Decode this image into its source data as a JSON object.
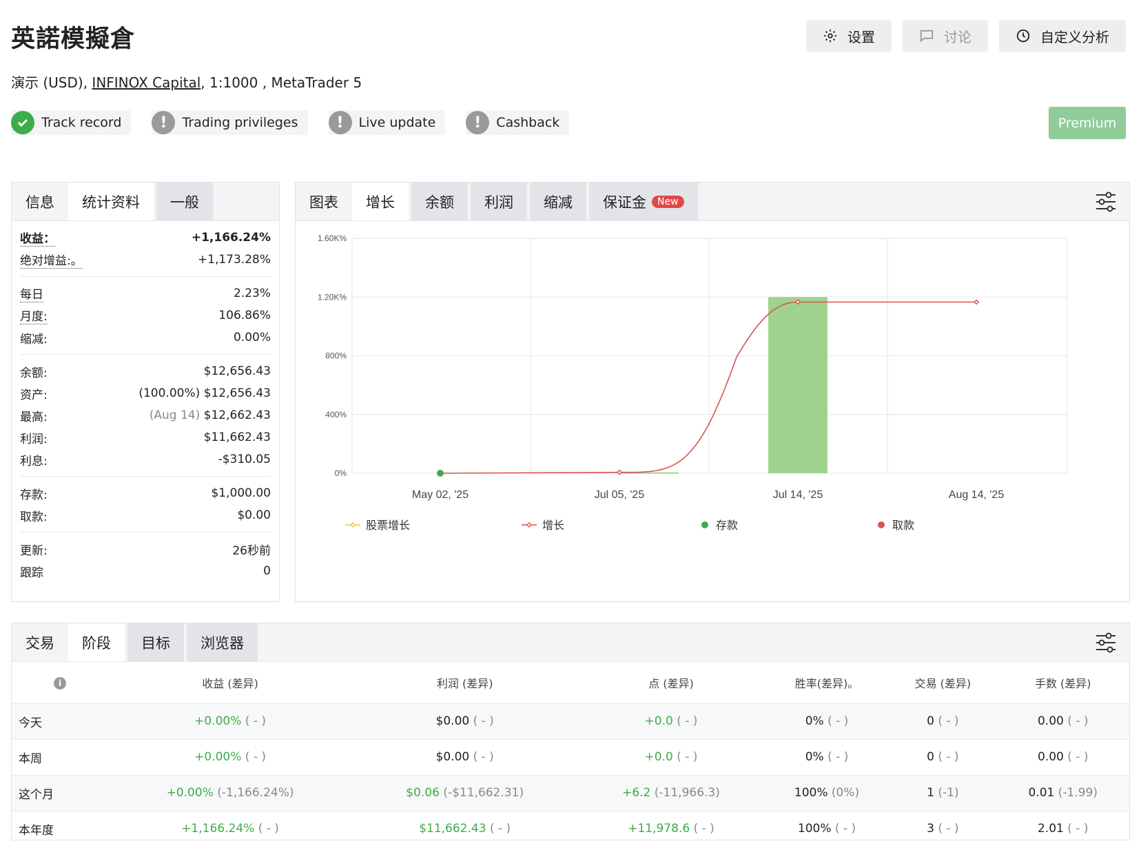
{
  "header": {
    "title": "英諾模擬倉",
    "subtitle_prefix": "演示 (USD), ",
    "broker_link": "INFINOX Capital",
    "subtitle_suffix": ", 1:1000 , MetaTrader 5",
    "buttons": {
      "settings": "设置",
      "discuss": "讨论",
      "custom_analysis": "自定义分析"
    }
  },
  "badges": [
    {
      "label": "Track record",
      "status": "ok"
    },
    {
      "label": "Trading privileges",
      "status": "warn"
    },
    {
      "label": "Live update",
      "status": "warn"
    },
    {
      "label": "Cashback",
      "status": "warn"
    }
  ],
  "premium_label": "Premium",
  "info_panel": {
    "tabs": [
      "信息",
      "统计资料",
      "一般"
    ],
    "rows": {
      "gain_label": "收益：",
      "gain_value": "+1,166.24%",
      "abs_gain_label": "绝对增益:。",
      "abs_gain_value": "+1,173.28%",
      "daily_label": "每日",
      "daily_value": "2.23%",
      "monthly_label": "月度:",
      "monthly_value": "106.86%",
      "drawdown_label": "缩减:",
      "drawdown_value": "0.00%",
      "balance_label": "余额:",
      "balance_value": "$12,656.43",
      "equity_label": "资产:",
      "equity_pct": "(100.00%)",
      "equity_value": "$12,656.43",
      "highest_label": "最高:",
      "highest_date": "(Aug 14)",
      "highest_value": "$12,662.43",
      "profit_label": "利润:",
      "profit_value": "$11,662.43",
      "interest_label": "利息:",
      "interest_value": "-$310.05",
      "deposits_label": "存款:",
      "deposits_value": "$1,000.00",
      "withdrawals_label": "取款:",
      "withdrawals_value": "$0.00",
      "updated_label": "更新:",
      "updated_value": "26秒前",
      "tracking_label": "跟踪",
      "tracking_value": "0"
    }
  },
  "chart_panel": {
    "tabs": [
      "图表",
      "增长",
      "余额",
      "利润",
      "缩减",
      "保证金"
    ],
    "new_badge": "New"
  },
  "chart_data": {
    "type": "line",
    "x_tick_labels": [
      "May 02, '25",
      "Jul 05, '25",
      "Jul 14, '25",
      "Aug 14, '25"
    ],
    "y_tick_labels": [
      "0%",
      "400%",
      "800%",
      "1.20K%",
      "1.60K%"
    ],
    "ylim": [
      0,
      1600
    ],
    "grid": true,
    "legend_position": "bottom",
    "series": [
      {
        "name": "股票增长",
        "color": "#f0c24a",
        "points": []
      },
      {
        "name": "增长",
        "color": "#d9534f",
        "points": [
          {
            "x": "May 02, '25",
            "y": 0
          },
          {
            "x": "Jul 05, '25",
            "y": 6
          },
          {
            "x": "Jul 14, '25",
            "y": 1166
          },
          {
            "x": "Aug 14, '25",
            "y": 1166
          }
        ]
      },
      {
        "name": "存款",
        "color": "#3cad4a",
        "points": [
          {
            "x": "May 02, '25",
            "y": 0
          }
        ]
      },
      {
        "name": "取款",
        "color": "#d9534f",
        "points": []
      }
    ],
    "bars": [
      {
        "x": "Jul 05, '25",
        "y": 6,
        "color": "#9fd28f"
      },
      {
        "x": "Jul 14, '25",
        "y": 1200,
        "color": "#9fd28f"
      }
    ]
  },
  "periods_panel": {
    "tabs": [
      "交易",
      "阶段",
      "目标",
      "浏览器"
    ],
    "columns": [
      "收益 (差异)",
      "利润 (差异)",
      "点 (差异)",
      "胜率(差异)。",
      "交易 (差异)",
      "手数 (差异)"
    ],
    "rows": [
      {
        "label": "今天",
        "cells": [
          [
            "+0.00%",
            "( - )"
          ],
          [
            "$0.00",
            "( - )"
          ],
          [
            "+0.0",
            "( - )"
          ],
          [
            "0%",
            "( - )"
          ],
          [
            "0",
            "( - )"
          ],
          [
            "0.00",
            "( - )"
          ]
        ]
      },
      {
        "label": "本周",
        "cells": [
          [
            "+0.00%",
            "( - )"
          ],
          [
            "$0.00",
            "( - )"
          ],
          [
            "+0.0",
            "( - )"
          ],
          [
            "0%",
            "( - )"
          ],
          [
            "0",
            "( - )"
          ],
          [
            "0.00",
            "( - )"
          ]
        ]
      },
      {
        "label": "这个月",
        "cells": [
          [
            "+0.00%",
            "(-1,166.24%)"
          ],
          [
            "$0.06",
            "(-$11,662.31)"
          ],
          [
            "+6.2",
            "(-11,966.3)"
          ],
          [
            "100%",
            "(0%)"
          ],
          [
            "1",
            "(-1)"
          ],
          [
            "0.01",
            "(-1.99)"
          ]
        ]
      },
      {
        "label": "本年度",
        "cells": [
          [
            "+1,166.24%",
            "( - )"
          ],
          [
            "$11,662.43",
            "( - )"
          ],
          [
            "+11,978.6",
            "( - )"
          ],
          [
            "100%",
            "( - )"
          ],
          [
            "3",
            "( - )"
          ],
          [
            "2.01",
            "( - )"
          ]
        ]
      }
    ]
  }
}
